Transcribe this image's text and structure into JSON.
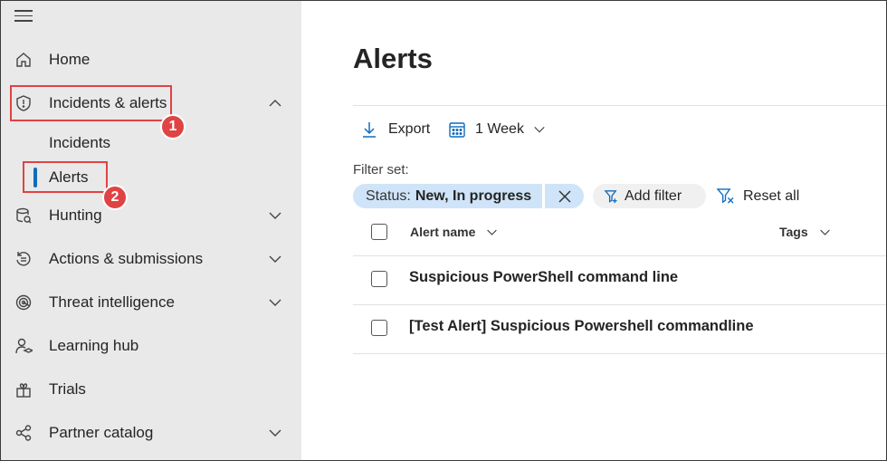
{
  "sidebar": {
    "items": [
      {
        "label": "Home"
      },
      {
        "label": "Incidents & alerts"
      },
      {
        "label": "Hunting"
      },
      {
        "label": "Actions & submissions"
      },
      {
        "label": "Threat intelligence"
      },
      {
        "label": "Learning hub"
      },
      {
        "label": "Trials"
      },
      {
        "label": "Partner catalog"
      }
    ],
    "sub_items": [
      {
        "label": "Incidents"
      },
      {
        "label": "Alerts"
      }
    ],
    "badges": [
      "1",
      "2"
    ]
  },
  "main": {
    "title": "Alerts",
    "toolbar": {
      "export_label": "Export",
      "period_label": "1 Week"
    },
    "filter": {
      "label": "Filter set:",
      "pill_key": "Status:",
      "pill_value": "New, In progress",
      "add_filter_label": "Add filter",
      "reset_label": "Reset all"
    },
    "table": {
      "columns": [
        "Alert name",
        "Tags"
      ],
      "rows": [
        {
          "name": "Suspicious PowerShell command line"
        },
        {
          "name": "[Test Alert] Suspicious Powershell commandline"
        }
      ]
    }
  },
  "colors": {
    "accent": "#0f6cbd",
    "annotation": "#e04343",
    "pill": "#cfe4f8",
    "sidebar_bg": "#e9e9e9"
  }
}
